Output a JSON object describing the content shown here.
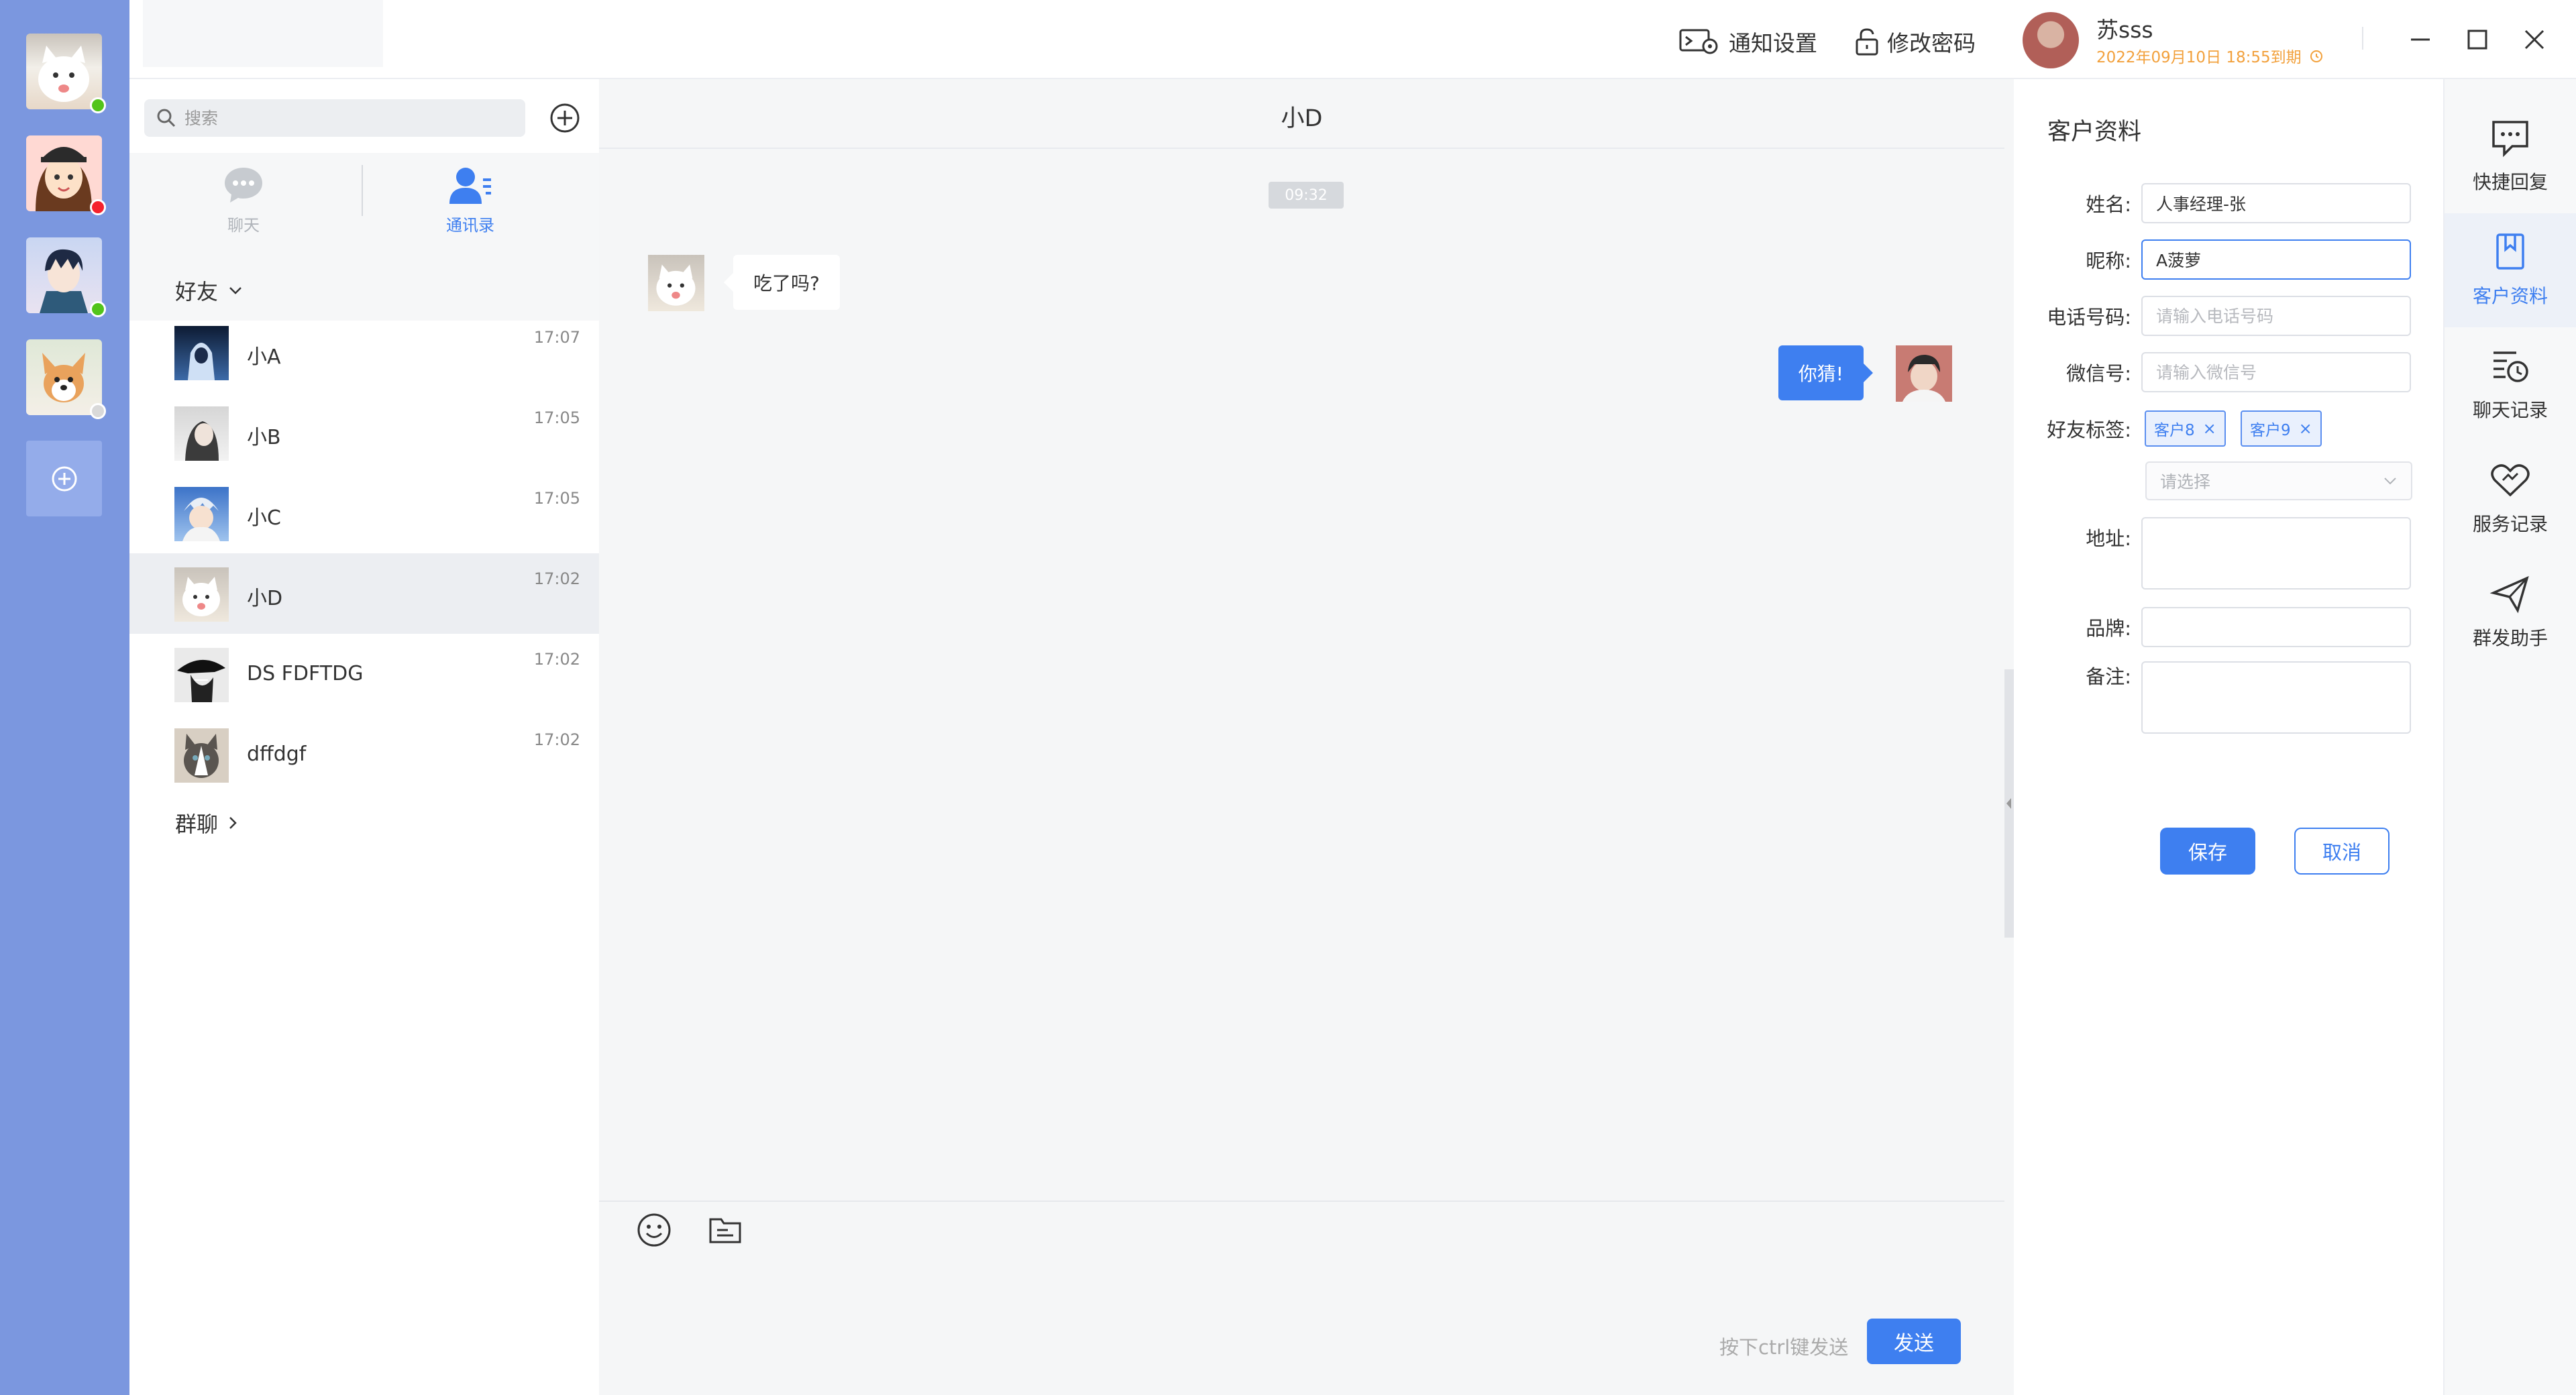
{
  "accounts": [
    {
      "avatar": "white-kitten-avatar",
      "status": "online",
      "status_color": "#52c41a"
    },
    {
      "avatar": "cartoon-girl-avatar",
      "status": "busy",
      "status_color": "#f5222d"
    },
    {
      "avatar": "anime-boy-avatar",
      "status": "online",
      "status_color": "#52c41a"
    },
    {
      "avatar": "corgi-avatar",
      "status": "offline",
      "status_color": "#d9d9d9"
    }
  ],
  "topbar": {
    "notify_label": "通知设置",
    "password_label": "修改密码",
    "user_name": "苏sss",
    "expire_text": "2022年09月10日 18:55到期"
  },
  "search": {
    "placeholder": "搜索"
  },
  "side_tabs": {
    "chat": "聊天",
    "contacts": "通讯录"
  },
  "contacts": {
    "friends_label": "好友",
    "groups_label": "群聊",
    "items": [
      {
        "name": "小A",
        "time": "17:07"
      },
      {
        "name": "小B",
        "time": "17:05"
      },
      {
        "name": "小C",
        "time": "17:05"
      },
      {
        "name": "小D",
        "time": "17:02"
      },
      {
        "name": "DS FDFTDG",
        "time": "17:02"
      },
      {
        "name": "dffdgf",
        "time": "17:02"
      }
    ]
  },
  "chat": {
    "title": "小D",
    "time_divider": "09:32",
    "incoming_text": "吃了吗?",
    "outgoing_text": "你猜!",
    "send_hint": "按下ctrl键发送",
    "send_label": "发送"
  },
  "profile": {
    "title": "客户资料",
    "labels": {
      "name": "姓名:",
      "nickname": "昵称:",
      "phone": "电话号码:",
      "wechat": "微信号:",
      "tags": "好友标签:",
      "address": "地址:",
      "brand": "品牌:",
      "note": "备注:"
    },
    "values": {
      "name": "人事经理-张",
      "nickname": "A菠萝"
    },
    "placeholders": {
      "phone": "请输入电话号码",
      "wechat": "请输入微信号"
    },
    "tags": [
      "客户8",
      "客户9"
    ],
    "tag_select_placeholder": "请选择",
    "save_label": "保存",
    "cancel_label": "取消"
  },
  "tools": [
    {
      "label": "快捷回复",
      "icon": "quick-reply-icon"
    },
    {
      "label": "客户资料",
      "icon": "customer-profile-icon"
    },
    {
      "label": "聊天记录",
      "icon": "chat-history-icon"
    },
    {
      "label": "服务记录",
      "icon": "service-record-icon"
    },
    {
      "label": "群发助手",
      "icon": "broadcast-icon"
    }
  ],
  "colors": {
    "accent": "#3e7ff0",
    "rail": "#7b97df",
    "expire": "#f2a03b"
  }
}
